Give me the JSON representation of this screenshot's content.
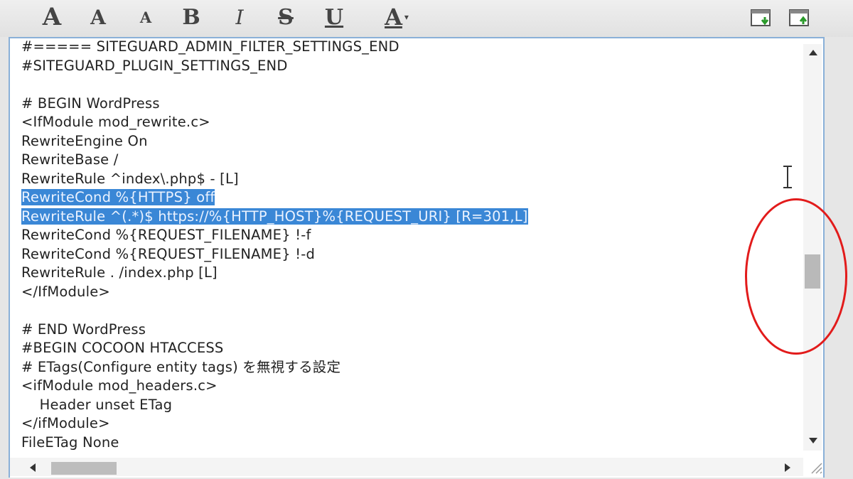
{
  "toolbar": {
    "font_large": "A",
    "font_medium": "A",
    "font_small": "A",
    "bold": "B",
    "italic": "I",
    "strikethrough": "S",
    "underline": "U",
    "text_color": "A",
    "text_color_caret": "▾",
    "icons": [
      "import-icon",
      "export-icon"
    ]
  },
  "editor": {
    "lines": [
      {
        "text": "#===== SITEGUARD_ADMIN_FILTER_SETTINGS_END",
        "selected": false
      },
      {
        "text": "#SITEGUARD_PLUGIN_SETTINGS_END",
        "selected": false
      },
      {
        "text": "",
        "selected": false
      },
      {
        "text": "# BEGIN WordPress",
        "selected": false
      },
      {
        "text": "<IfModule mod_rewrite.c>",
        "selected": false
      },
      {
        "text": "RewriteEngine On",
        "selected": false
      },
      {
        "text": "RewriteBase /",
        "selected": false
      },
      {
        "text": "RewriteRule ^index\\.php$ - [L]",
        "selected": false
      },
      {
        "text": "RewriteCond %{HTTPS} off",
        "selected": true
      },
      {
        "text": "RewriteRule ^(.*)$ https://%{HTTP_HOST}%{REQUEST_URI} [R=301,L]",
        "selected": true
      },
      {
        "text": "RewriteCond %{REQUEST_FILENAME} !-f",
        "selected": false
      },
      {
        "text": "RewriteCond %{REQUEST_FILENAME} !-d",
        "selected": false
      },
      {
        "text": "RewriteRule . /index.php [L]",
        "selected": false
      },
      {
        "text": "</IfModule>",
        "selected": false
      },
      {
        "text": "",
        "selected": false
      },
      {
        "text": "# END WordPress",
        "selected": false
      },
      {
        "text": "#BEGIN COCOON HTACCESS",
        "selected": false
      },
      {
        "text": "# ETags(Configure entity tags) を無視する設定",
        "selected": false
      },
      {
        "text": "<ifModule mod_headers.c>",
        "selected": false
      },
      {
        "text": "    Header unset ETag",
        "selected": false
      },
      {
        "text": "</ifModule>",
        "selected": false
      },
      {
        "text": "FileETag None",
        "selected": false
      }
    ]
  },
  "colors": {
    "selection": "#3a87d6",
    "editor_border": "#8ab0d8",
    "annotation": "#e21b1b"
  }
}
